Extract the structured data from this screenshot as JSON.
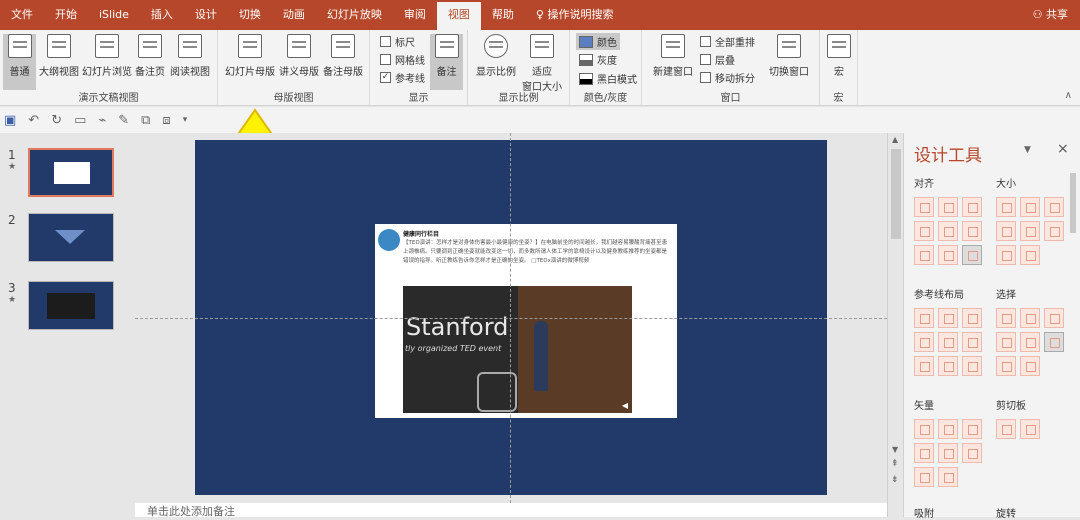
{
  "tabs": [
    "文件",
    "开始",
    "iSlide",
    "插入",
    "设计",
    "切换",
    "动画",
    "幻灯片放映",
    "审阅",
    "视图",
    "帮助",
    "操作说明搜索"
  ],
  "active_tab": "视图",
  "share_label": "共享",
  "ribbon": {
    "presentation_views": {
      "label": "演示文稿视图",
      "buttons": [
        "普通",
        "大纲视图",
        "幻灯片浏览",
        "备注页",
        "阅读视图"
      ]
    },
    "master_views": {
      "label": "母版视图",
      "buttons": [
        "幻灯片母版",
        "讲义母版",
        "备注母版"
      ]
    },
    "show": {
      "label": "显示",
      "ruler": "标尺",
      "gridlines": "网格线",
      "guides": "参考线",
      "guides_checked": true,
      "notes": "备注"
    },
    "zoom": {
      "label": "显示比例",
      "zoom_btn": "显示比例",
      "fit_btn_line1": "适应",
      "fit_btn_line2": "窗口大小"
    },
    "color": {
      "label": "颜色/灰度",
      "color": "颜色",
      "grayscale": "灰度",
      "bw": "黑白模式"
    },
    "window": {
      "label": "窗口",
      "new_window": "新建窗口",
      "arrange_all": "全部重排",
      "cascade": "层叠",
      "move_split": "移动拆分",
      "switch_window": "切换窗口"
    },
    "macro": {
      "label": "宏",
      "macro_btn": "宏"
    }
  },
  "slides": [
    {
      "num": "1",
      "star": "★"
    },
    {
      "num": "2"
    },
    {
      "num": "3",
      "star": "★"
    }
  ],
  "slide_post": {
    "name": "健康同行栏目",
    "text": "【TED演讲：怎样才是对身体伤害最小最健康的坐姿？】在电脑前坐的时间越长，我们越容易腰酸背痛甚至患上颈椎病。只要调到正确坐姿就能改变这一切，而多数所谓人体工学的靠椅设计以及健身教练推荐的坐姿都是错误的指导。听正教练告诉你怎样才是正确的坐姿。 □TEDx演讲的微博视频",
    "video_title": "Stanford",
    "video_sub": "tly organized TED event"
  },
  "notes_placeholder": "单击此处添加备注",
  "panel": {
    "title": "设计工具",
    "align": "对齐",
    "size": "大小",
    "guide_layout": "参考线布局",
    "select": "选择",
    "vector": "矢量",
    "clipboard": "剪切板",
    "bottom_left": "吸附",
    "bottom_right": "旋转"
  }
}
